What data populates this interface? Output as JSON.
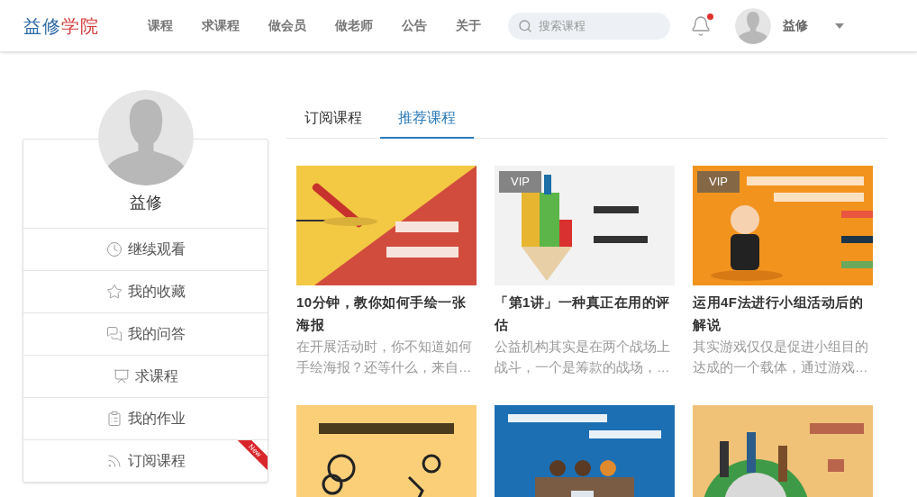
{
  "header": {
    "logo": {
      "first": "益修",
      "second": "学院"
    },
    "nav": [
      "课程",
      "求课程",
      "做会员",
      "做老师",
      "公告",
      "关于"
    ],
    "search": {
      "placeholder": "搜索课程"
    },
    "notifications": {
      "unread": true
    },
    "user": {
      "name": "益修"
    }
  },
  "profile": {
    "name": "益修",
    "menu": [
      {
        "label": "继续观看"
      },
      {
        "label": "我的收藏"
      },
      {
        "label": "我的问答"
      },
      {
        "label": "求课程"
      },
      {
        "label": "我的作业"
      },
      {
        "label": "订阅课程",
        "ribbon": "New"
      }
    ]
  },
  "tabs": [
    {
      "label": "订阅课程",
      "selected": false
    },
    {
      "label": "推荐课程",
      "selected": true
    }
  ],
  "courses": [
    {
      "kind": "course",
      "title": "10分钟，教你如何手绘一张海报",
      "description": "在开展活动时，你不知道如何手绘海报？还等什么，来自…"
    },
    {
      "kind": "course",
      "badge": "VIP",
      "title": "「第1讲」一种真正在用的评估",
      "description": "公益机构其实是在两个战场上战斗，一个是筹款的战场，…"
    },
    {
      "kind": "course",
      "badge": "VIP",
      "title": "运用4F法进行小组活动后的解说",
      "description": "其实游戏仅仅是促进小组目的达成的一个载体，通过游戏…"
    },
    {
      "kind": "picture"
    },
    {
      "kind": "picture"
    },
    {
      "kind": "picture"
    }
  ]
}
